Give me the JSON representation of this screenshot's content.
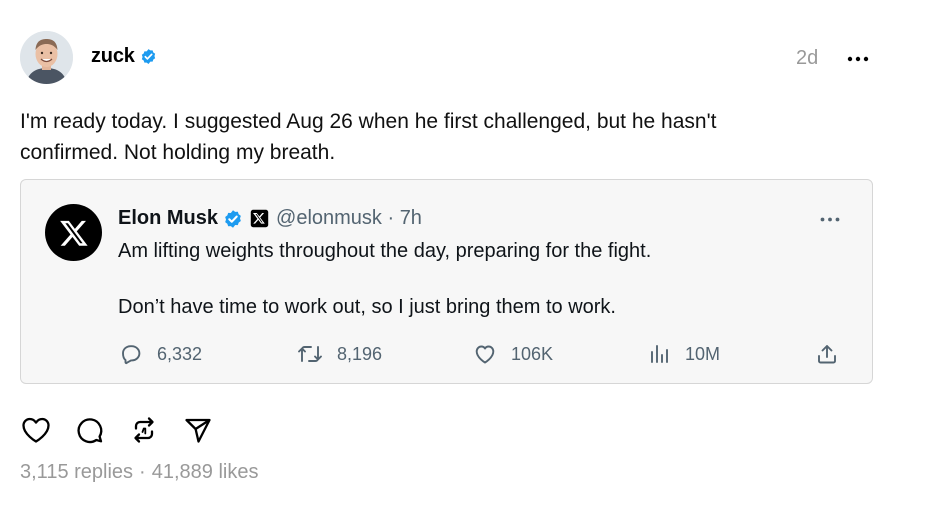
{
  "post": {
    "username": "zuck",
    "time_ago": "2d",
    "text_line1": "I'm ready today. I suggested Aug 26 when he first challenged, but he hasn't",
    "text_line2": "confirmed. Not holding my breath."
  },
  "embed": {
    "name": "Elon Musk",
    "handle_time": "@elonmusk · 7h",
    "line1": "Am lifting weights throughout the day, preparing for the fight.",
    "line2": "Don’t have time to work out, so I just bring them to work.",
    "stats": {
      "replies": "6,332",
      "reposts": "8,196",
      "likes": "106K",
      "views": "10M"
    }
  },
  "footer": {
    "replies": "3,115 replies",
    "separator": "·",
    "likes": "41,889 likes"
  },
  "icons": {
    "verified": "verified-badge-icon",
    "x_logo": "x-logo-icon",
    "more": "more-horizontal-icon",
    "reply": "reply-bubble-icon",
    "repost": "repost-icon",
    "like": "heart-icon",
    "views": "bar-chart-icon",
    "share": "share-upload-icon",
    "send": "send-icon"
  },
  "colors": {
    "verified_blue": "#1d9bf0",
    "muted_text": "#999999",
    "x_secondary": "#536471",
    "card_bg": "#f7f7f7"
  }
}
